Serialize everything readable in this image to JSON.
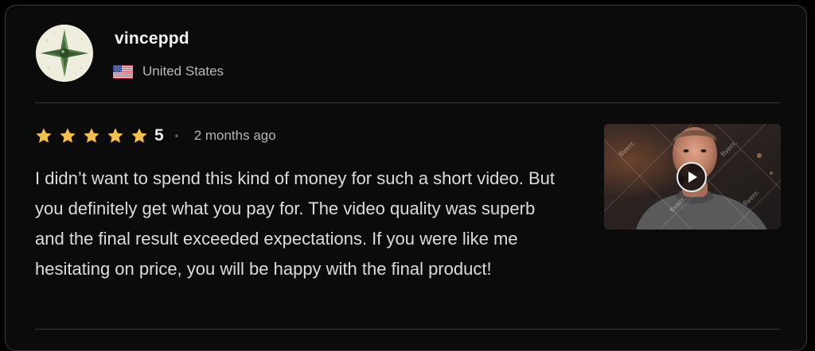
{
  "reviewer": {
    "username": "vinceppd",
    "country": "United States",
    "flag_icon": "us-flag-icon",
    "avatar_icon": "green-star-compass-icon"
  },
  "review": {
    "rating": 5,
    "rating_label": "5",
    "stars_filled": 5,
    "star_color": "#f5c04a",
    "time_ago": "2 months ago",
    "text": "I didn’t want to spend this kind of money for such a short video. But you definitely get what you pay for. The video quality was superb and the final result exceeded expectations. If you were like me hesitating on price, you will be happy with the final product!"
  },
  "media": {
    "type": "video",
    "watermark": "fiverr.",
    "play_icon": "play-icon"
  }
}
